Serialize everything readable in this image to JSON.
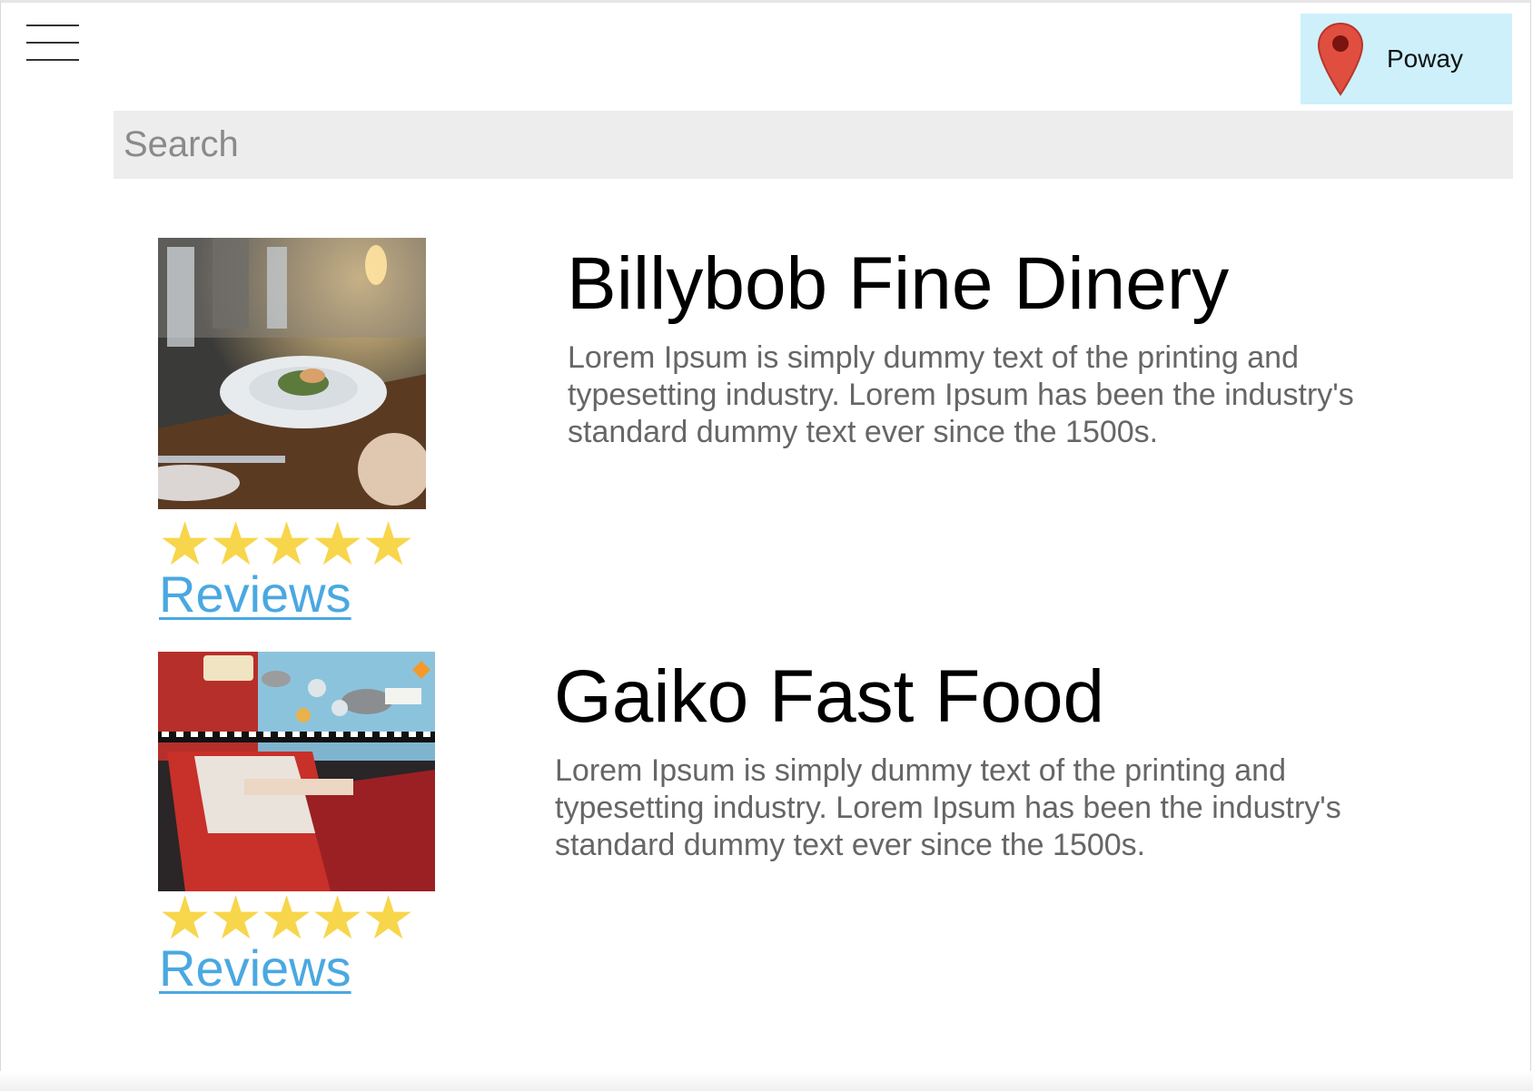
{
  "header": {
    "menu_icon": "hamburger-menu-icon",
    "location": {
      "icon": "map-pin-icon",
      "label": "Poway",
      "background": "#cdf0fb",
      "pin_color": "#e04e3f"
    }
  },
  "search": {
    "placeholder": "Search"
  },
  "restaurants": [
    {
      "name": "Billybob Fine Dinery",
      "description": "Lorem Ipsum is simply dummy text of the printing and typesetting industry. Lorem Ipsum has been the industry's standard dummy text ever since the 1500s.",
      "rating": 5,
      "rating_max": 5,
      "reviews_label": "Reviews",
      "image": "fine-dining-plate-photo"
    },
    {
      "name": "Gaiko Fast Food",
      "description": "Lorem Ipsum is simply dummy text of the printing and typesetting industry. Lorem Ipsum has been the industry's standard dummy text ever since the 1500s.",
      "rating": 5,
      "rating_max": 5,
      "reviews_label": "Reviews",
      "image": "retro-diner-booths-photo"
    }
  ],
  "colors": {
    "star": "#f7d64b",
    "link": "#4aa8e1",
    "search_bg": "#eeeded"
  }
}
